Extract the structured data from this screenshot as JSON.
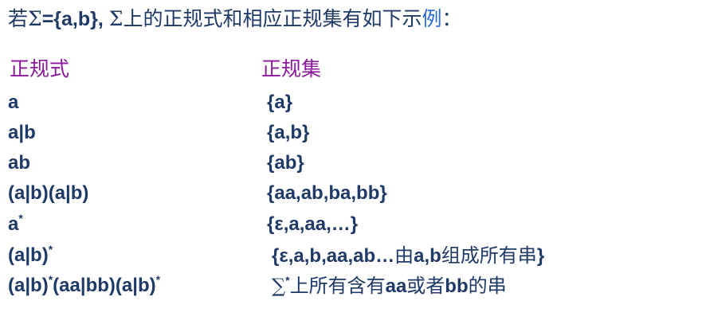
{
  "title": {
    "prefix": "若",
    "sigma": "Σ",
    "set": "={a,b}",
    "comma_sep": ", ",
    "sigma2": "Σ",
    "text": "上的正规式和相应正规集有如下示",
    "highlight": "例",
    "suffix": "："
  },
  "headers": {
    "regex": "正规式",
    "set": "正规集"
  },
  "rows": [
    {
      "regex_parts": [
        "a"
      ],
      "set_parts": [
        "{a}"
      ]
    },
    {
      "regex_parts": [
        "a|b"
      ],
      "set_parts": [
        "{a,b}"
      ]
    },
    {
      "regex_parts": [
        "ab"
      ],
      "set_parts": [
        "{ab}"
      ]
    },
    {
      "regex_parts": [
        "(a|b)(a|b)"
      ],
      "set_parts": [
        "{aa,ab,ba,bb}"
      ]
    },
    {
      "regex_parts": [
        "a",
        "*"
      ],
      "set_parts": [
        "{ε,a,aa,…}"
      ]
    },
    {
      "regex_parts": [
        "(a|b)",
        "*"
      ],
      "set_parts": [
        "{ε,a,b,aa,ab…",
        "由",
        "a,b",
        "组成所有串",
        "}"
      ]
    },
    {
      "regex_parts": [
        "(a|b)",
        "*",
        "(aa|bb)(a|b)",
        "*"
      ],
      "set_parts": [
        "∑",
        "*",
        "上所有含有",
        "aa",
        "或者",
        "bb",
        "的串"
      ]
    }
  ],
  "colors": {
    "text": "#1f3a66",
    "header": "#8a1a9b",
    "highlight": "#2a6bd6",
    "background": "#ffffff"
  }
}
